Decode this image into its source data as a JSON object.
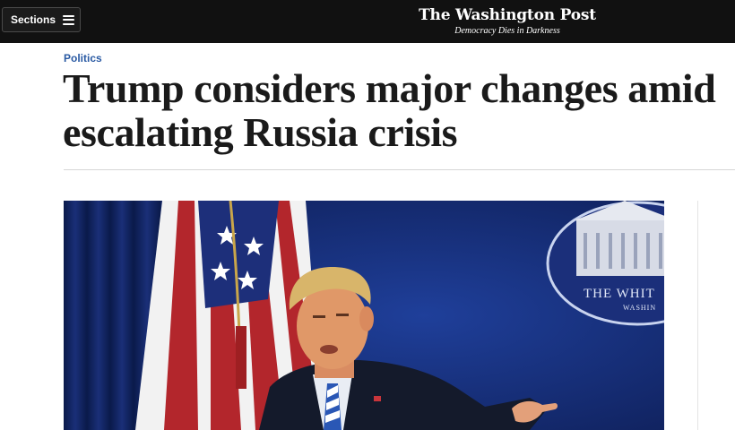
{
  "header": {
    "sections_label": "Sections",
    "logo_text": "The Washington Post",
    "tagline": "Democracy Dies in Darkness"
  },
  "article": {
    "kicker": "Politics",
    "headline": "Trump considers major changes amid escalating Russia crisis",
    "photo": {
      "seal_text_1": "THE WHIT",
      "seal_text_2": "WASHIN"
    }
  },
  "colors": {
    "topbar": "#111111",
    "kicker": "#2a5aa3",
    "headline": "#1a1a1a",
    "photo_backdrop": "#142a70"
  }
}
